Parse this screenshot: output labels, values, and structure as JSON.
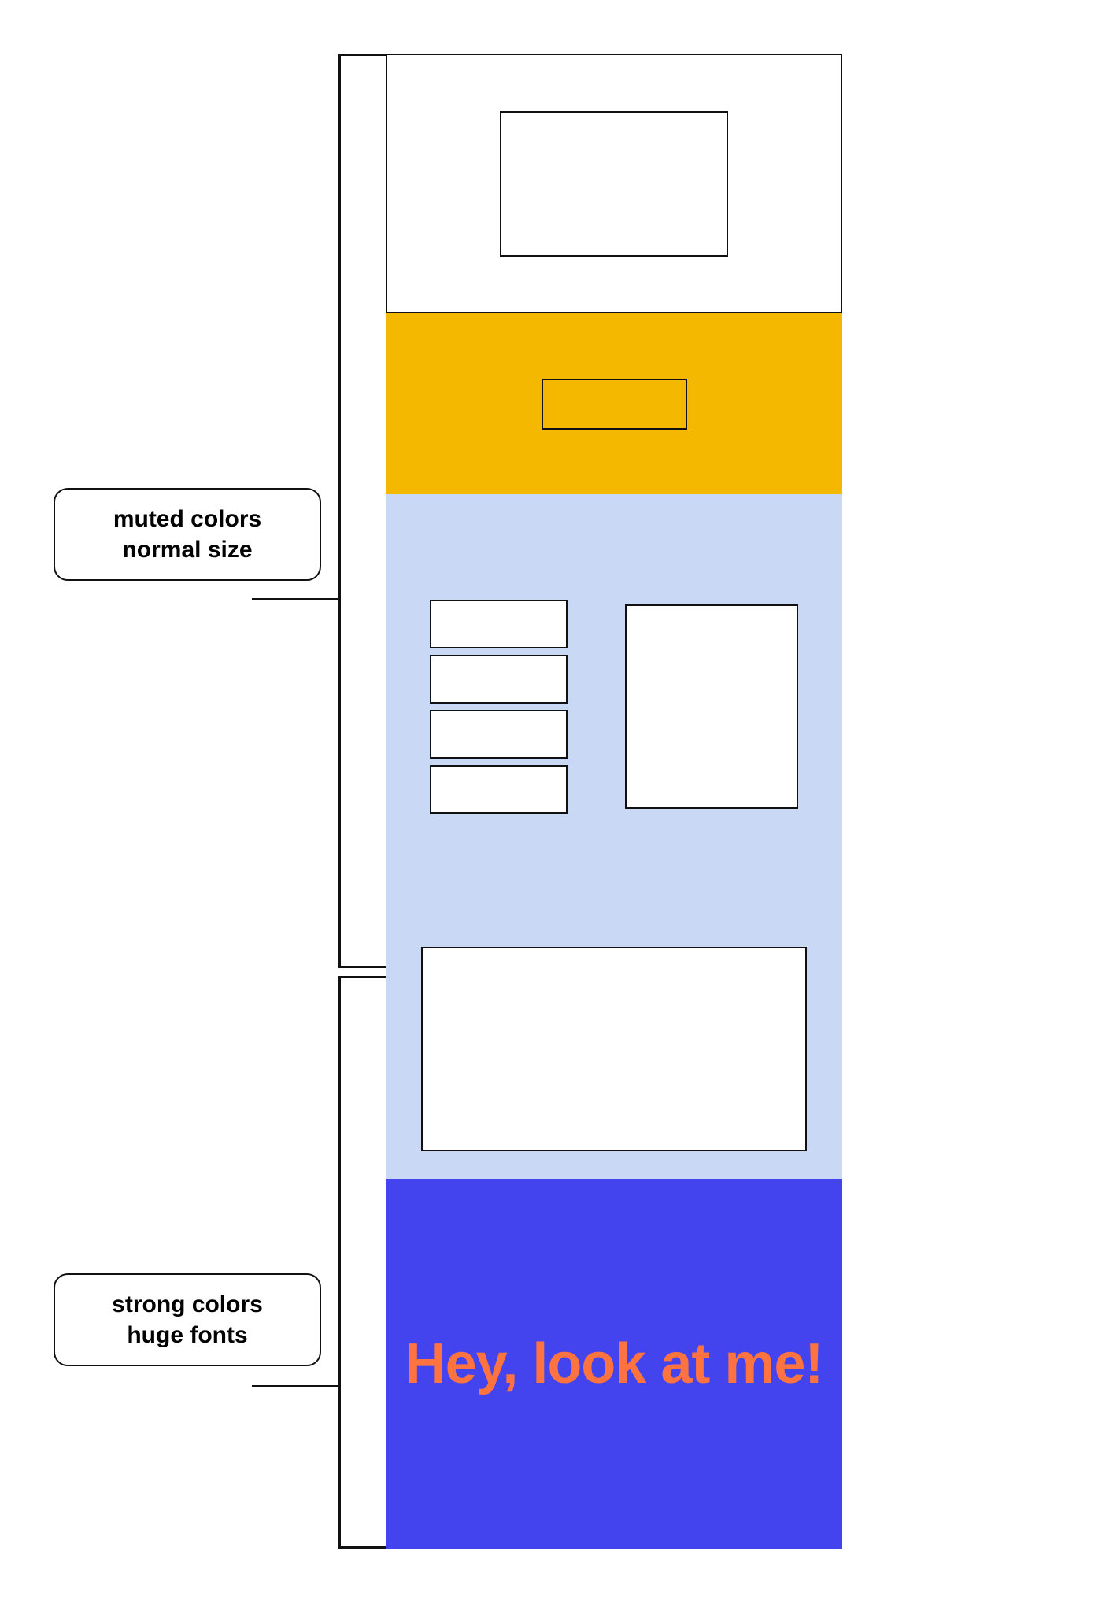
{
  "annotations": {
    "muted_label": "muted colors\nnormal size",
    "strong_label": "strong colors\nhuge fonts"
  },
  "sections": {
    "white": {
      "bg": "#ffffff"
    },
    "yellow": {
      "bg": "#F5B800"
    },
    "blue_light_grid": {
      "bg": "#C8D8F5"
    },
    "blue_light_wide": {
      "bg": "#C8D8F5"
    },
    "strong_blue": {
      "bg": "#4444EE",
      "text": "Hey, look at me!",
      "text_color": "#FF7340"
    }
  },
  "colors": {
    "border": "#111111",
    "accent_yellow": "#F5B800",
    "accent_blue_strong": "#4444EE",
    "accent_blue_light": "#C8D8F5",
    "accent_orange": "#FF7340"
  }
}
